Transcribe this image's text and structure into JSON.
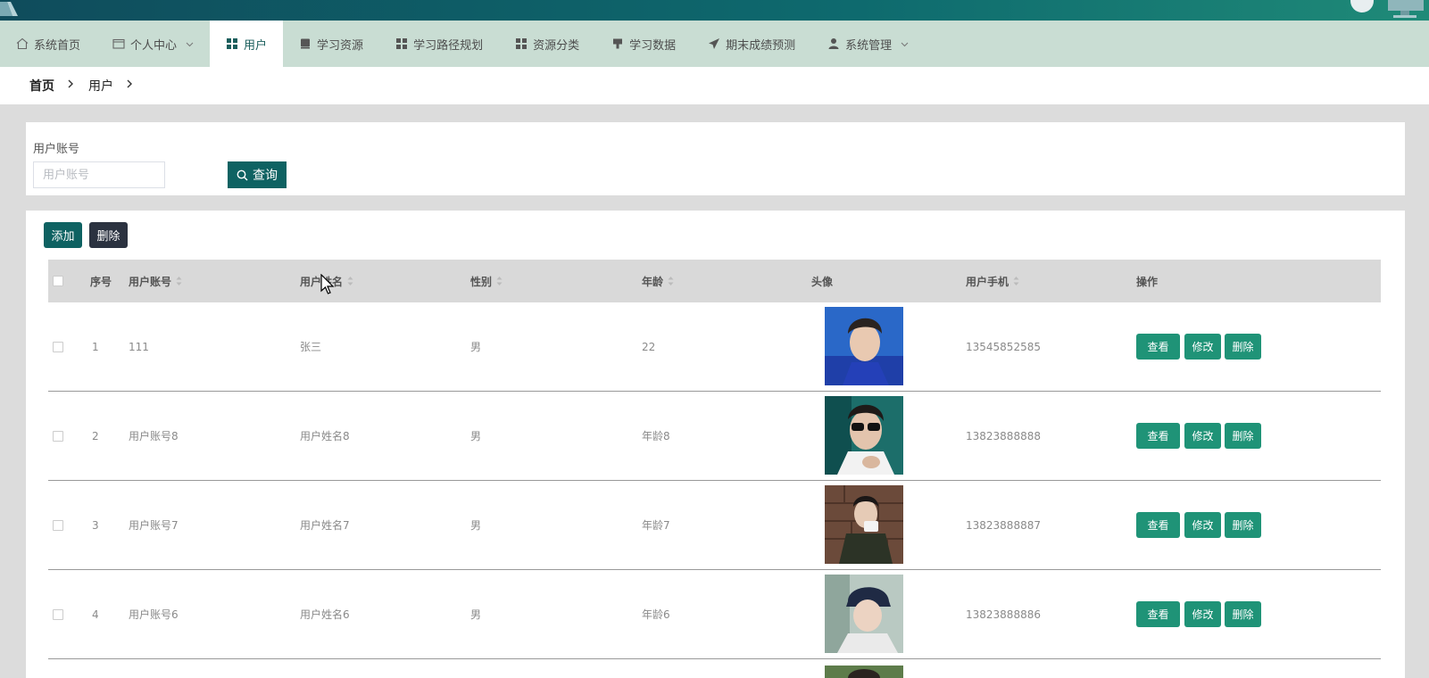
{
  "nav": {
    "items": [
      {
        "label": "系统首页",
        "icon": "home-icon"
      },
      {
        "label": "个人中心",
        "icon": "id-card-icon",
        "dropdown": true
      },
      {
        "label": "用户",
        "icon": "grid-icon",
        "active": true
      },
      {
        "label": "学习资源",
        "icon": "book-icon"
      },
      {
        "label": "学习路径规划",
        "icon": "grid-icon"
      },
      {
        "label": "资源分类",
        "icon": "grid-icon"
      },
      {
        "label": "学习数据",
        "icon": "podium-icon"
      },
      {
        "label": "期末成绩预测",
        "icon": "paper-plane-icon"
      },
      {
        "label": "系统管理",
        "icon": "user-icon",
        "dropdown": true
      }
    ]
  },
  "breadcrumb": {
    "home": "首页",
    "current": "用户"
  },
  "search": {
    "label": "用户账号",
    "placeholder": "用户账号",
    "button": "查询"
  },
  "toolbar": {
    "add": "添加",
    "delete": "删除"
  },
  "table": {
    "headers": {
      "index": "序号",
      "account": "用户账号",
      "name": "用户姓名",
      "gender": "性别",
      "age": "年龄",
      "avatar": "头像",
      "phone": "用户手机",
      "actions": "操作"
    },
    "rows": [
      {
        "index": "1",
        "account": "111",
        "name": "张三",
        "gender": "男",
        "age": "22",
        "phone": "13545852585"
      },
      {
        "index": "2",
        "account": "用户账号8",
        "name": "用户姓名8",
        "gender": "男",
        "age": "年龄8",
        "phone": "13823888888"
      },
      {
        "index": "3",
        "account": "用户账号7",
        "name": "用户姓名7",
        "gender": "男",
        "age": "年龄7",
        "phone": "13823888887"
      },
      {
        "index": "4",
        "account": "用户账号6",
        "name": "用户姓名6",
        "gender": "男",
        "age": "年龄6",
        "phone": "13823888886"
      }
    ],
    "row_actions": {
      "view": "查看",
      "edit": "修改",
      "delete": "删除"
    }
  },
  "colors": {
    "accent": "#0e6262",
    "action_green": "#1f9377",
    "nav_bg": "#c9ddd3",
    "dark_button": "#2b3240"
  }
}
